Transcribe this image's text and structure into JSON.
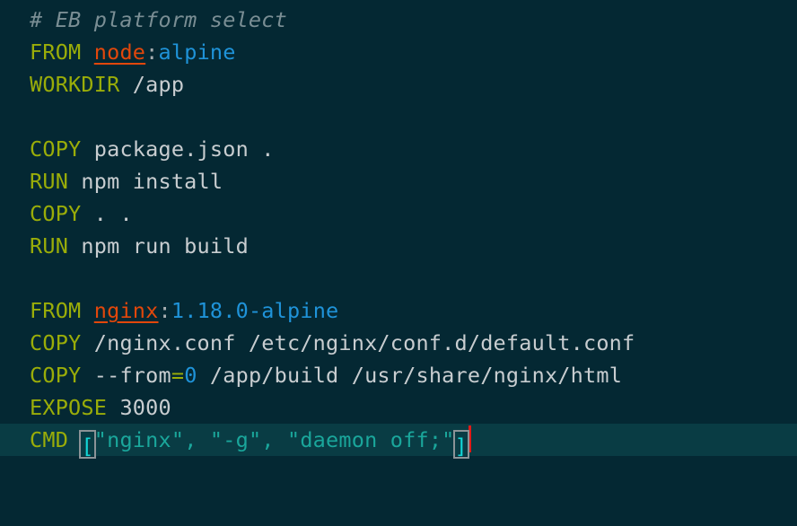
{
  "editor": {
    "language": "dockerfile",
    "filename_hint": "Dockerfile",
    "background_color": "#042833",
    "current_line_color": "#093c44",
    "caret_color": "#e01b18",
    "bracket_match_border_color": "#8b9397",
    "palette": {
      "comment": "#7a8e94",
      "keyword": "#9aad09",
      "image_name": "#e2470b",
      "tag": "#1f93d9",
      "string": "#1aa69b",
      "bracket": "#13d7d7",
      "plain_text": "#c8cdd0",
      "punctuation": "#a6adb0"
    },
    "current_line_number": 13,
    "lines": [
      {
        "index": 1,
        "tokens": [
          {
            "type": "comment",
            "text": "# EB platform select"
          }
        ]
      },
      {
        "index": 2,
        "tokens": [
          {
            "type": "keyword",
            "text": "FROM"
          },
          {
            "type": "plain",
            "text": " "
          },
          {
            "type": "image",
            "text": "node"
          },
          {
            "type": "punct",
            "text": ":"
          },
          {
            "type": "tag",
            "text": "alpine"
          }
        ]
      },
      {
        "index": 3,
        "tokens": [
          {
            "type": "keyword",
            "text": "WORKDIR"
          },
          {
            "type": "plain",
            "text": " /app"
          }
        ]
      },
      {
        "index": 4,
        "tokens": []
      },
      {
        "index": 5,
        "tokens": [
          {
            "type": "keyword",
            "text": "COPY"
          },
          {
            "type": "plain",
            "text": " package.json ."
          }
        ]
      },
      {
        "index": 6,
        "tokens": [
          {
            "type": "keyword",
            "text": "RUN"
          },
          {
            "type": "plain",
            "text": " npm install"
          }
        ]
      },
      {
        "index": 7,
        "tokens": [
          {
            "type": "keyword",
            "text": "COPY"
          },
          {
            "type": "plain",
            "text": " . ."
          }
        ]
      },
      {
        "index": 8,
        "tokens": [
          {
            "type": "keyword",
            "text": "RUN"
          },
          {
            "type": "plain",
            "text": " npm run build"
          }
        ]
      },
      {
        "index": 9,
        "tokens": []
      },
      {
        "index": 10,
        "tokens": [
          {
            "type": "keyword",
            "text": "FROM"
          },
          {
            "type": "plain",
            "text": " "
          },
          {
            "type": "image",
            "text": "nginx"
          },
          {
            "type": "punct",
            "text": ":"
          },
          {
            "type": "tag",
            "text": "1.18.0-alpine"
          }
        ]
      },
      {
        "index": 11,
        "tokens": [
          {
            "type": "keyword",
            "text": "COPY"
          },
          {
            "type": "plain",
            "text": " /nginx.conf /etc/nginx/conf.d/default.conf"
          }
        ]
      },
      {
        "index": 12,
        "tokens": [
          {
            "type": "keyword",
            "text": "COPY"
          },
          {
            "type": "plain",
            "text": " --from"
          },
          {
            "type": "keyword",
            "text": "="
          },
          {
            "type": "number",
            "text": "0"
          },
          {
            "type": "plain",
            "text": " /app/build /usr/share/nginx/html"
          }
        ]
      },
      {
        "index": 13,
        "tokens": [
          {
            "type": "keyword",
            "text": "EXPOSE"
          },
          {
            "type": "plain",
            "text": " 3000"
          }
        ]
      },
      {
        "index": 14,
        "current": true,
        "tokens": [
          {
            "type": "keyword",
            "text": "CMD"
          },
          {
            "type": "plain",
            "text": " "
          },
          {
            "type": "bracket-match",
            "text": "["
          },
          {
            "type": "string",
            "text": "\"nginx\", \"-g\", \"daemon off;\""
          },
          {
            "type": "bracket-match",
            "text": "]"
          },
          {
            "type": "caret",
            "text": ""
          }
        ]
      },
      {
        "index": 15,
        "tokens": []
      },
      {
        "index": 16,
        "tokens": []
      }
    ]
  }
}
